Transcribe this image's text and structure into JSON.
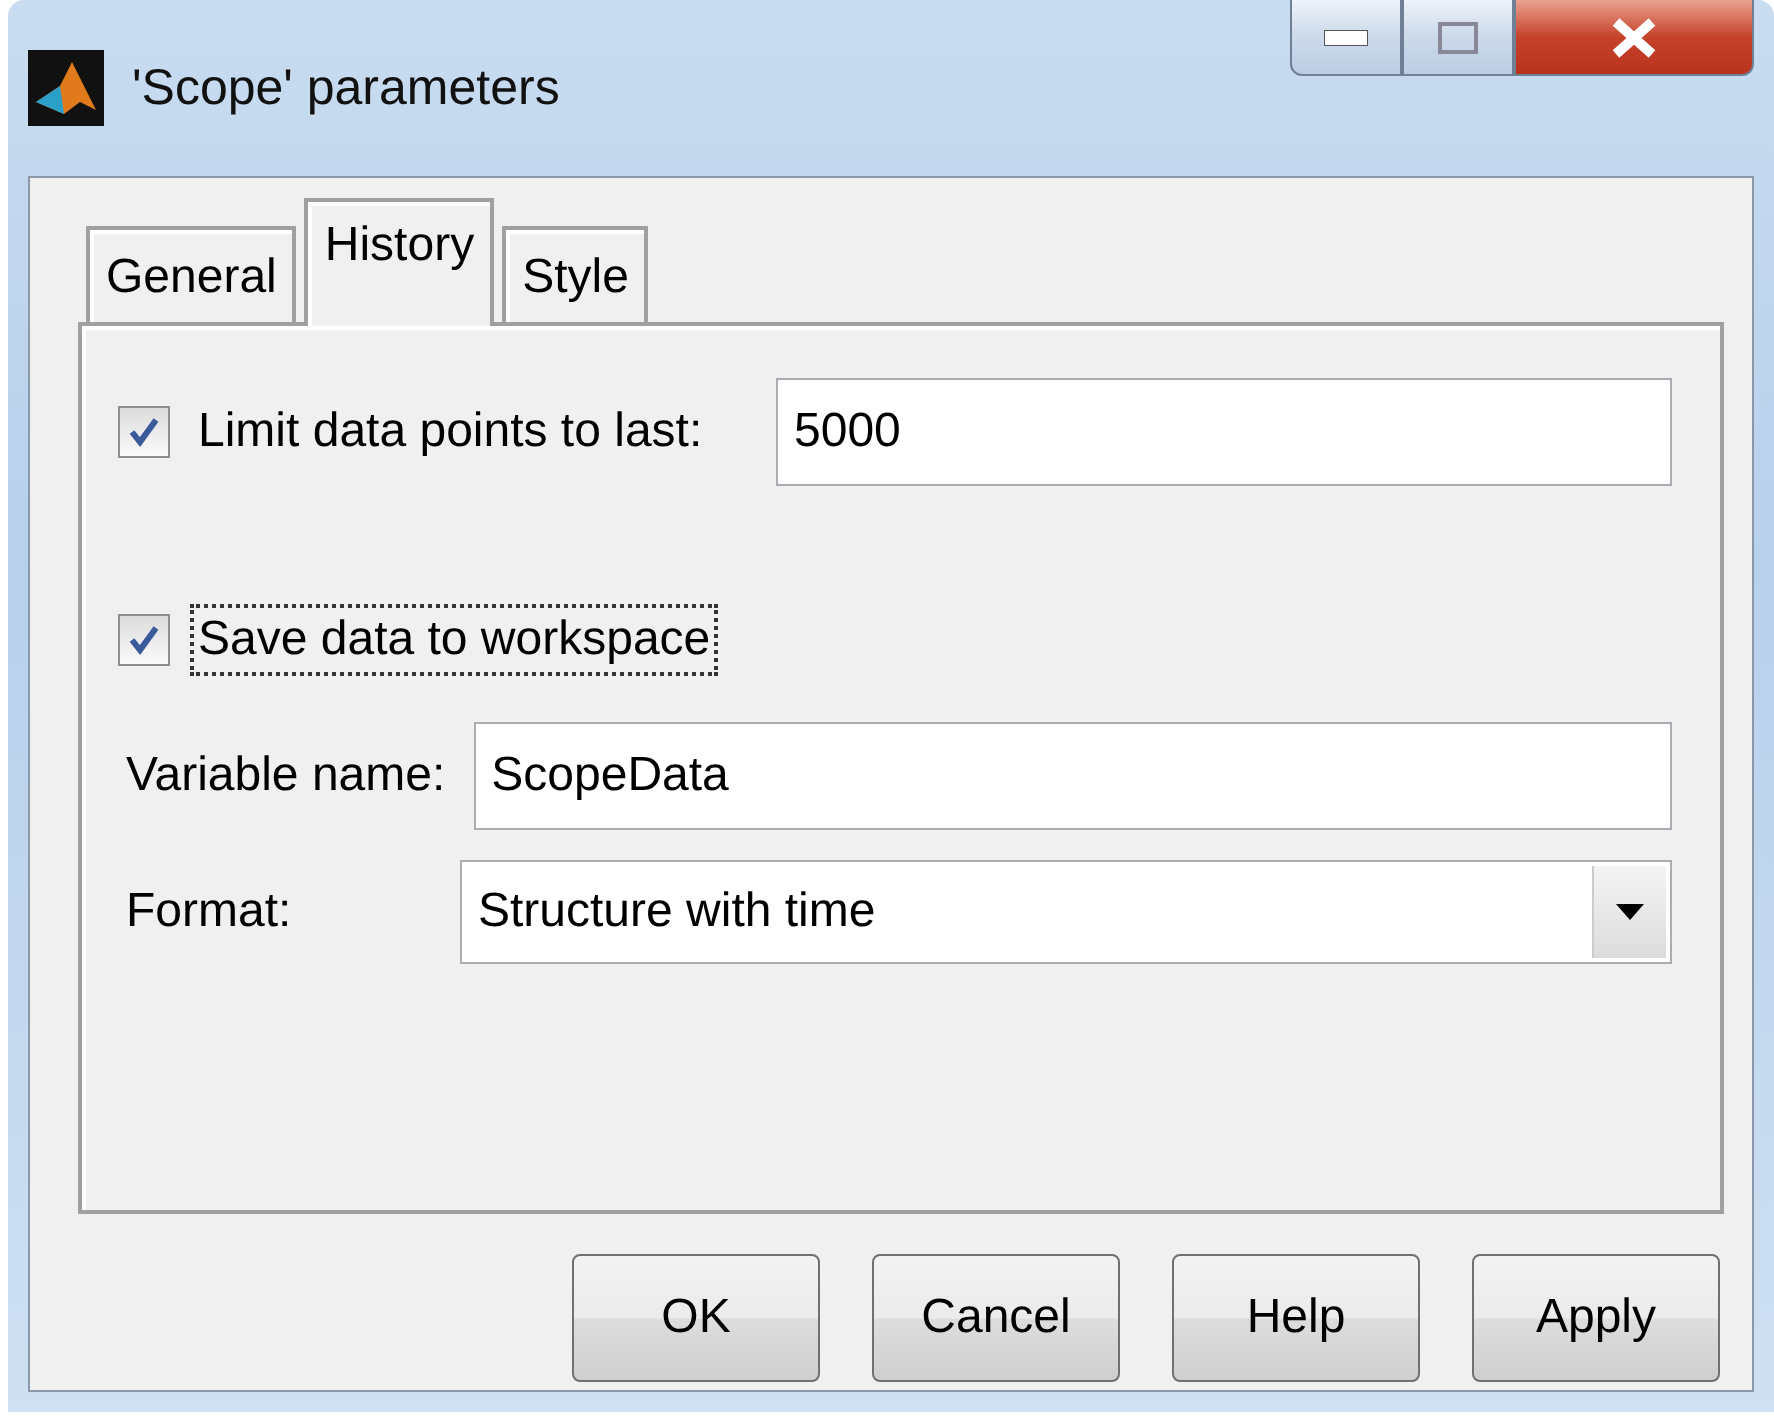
{
  "window": {
    "title": "'Scope' parameters"
  },
  "tabs": [
    {
      "label": "General",
      "selected": false
    },
    {
      "label": "History",
      "selected": true
    },
    {
      "label": "Style",
      "selected": false
    }
  ],
  "limit": {
    "label": "Limit data points to last:",
    "checked": true,
    "value": "5000"
  },
  "save": {
    "label": "Save data to workspace",
    "checked": true,
    "focused": true
  },
  "variable": {
    "label": "Variable name:",
    "value": "ScopeData"
  },
  "format": {
    "label": "Format:",
    "value": "Structure with time"
  },
  "buttons": [
    "OK",
    "Cancel",
    "Help",
    "Apply"
  ]
}
